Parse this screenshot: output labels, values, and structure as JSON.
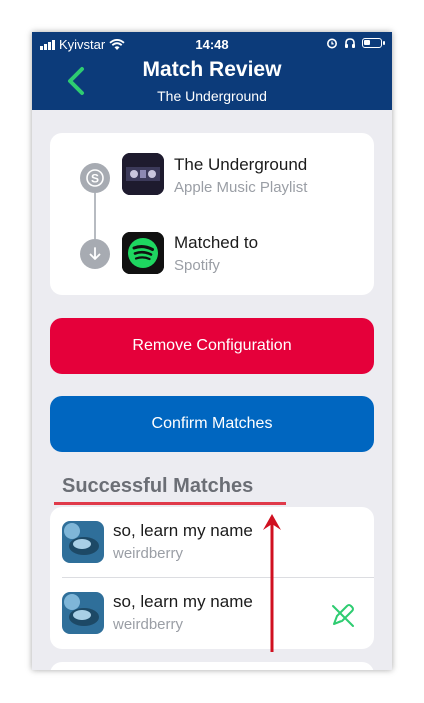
{
  "status_bar": {
    "carrier": "Kyivstar",
    "time": "14:48"
  },
  "header": {
    "title": "Match Review",
    "subtitle": "The Underground"
  },
  "source": {
    "title": "The Underground",
    "subtitle": "Apple Music Playlist"
  },
  "destination": {
    "title": "Matched to",
    "subtitle": "Spotify"
  },
  "buttons": {
    "remove": "Remove Configuration",
    "confirm": "Confirm Matches"
  },
  "section": {
    "title": "Successful Matches"
  },
  "matches": [
    {
      "title": "so, learn my name",
      "artist": "weirdberry"
    },
    {
      "title": "so, learn my name",
      "artist": "weirdberry"
    }
  ],
  "colors": {
    "header": "#0c3b7a",
    "accent_green": "#2ecc71",
    "remove_button": "#e5003a",
    "confirm_button": "#0066c0",
    "annotation_red": "#e03a4a"
  }
}
